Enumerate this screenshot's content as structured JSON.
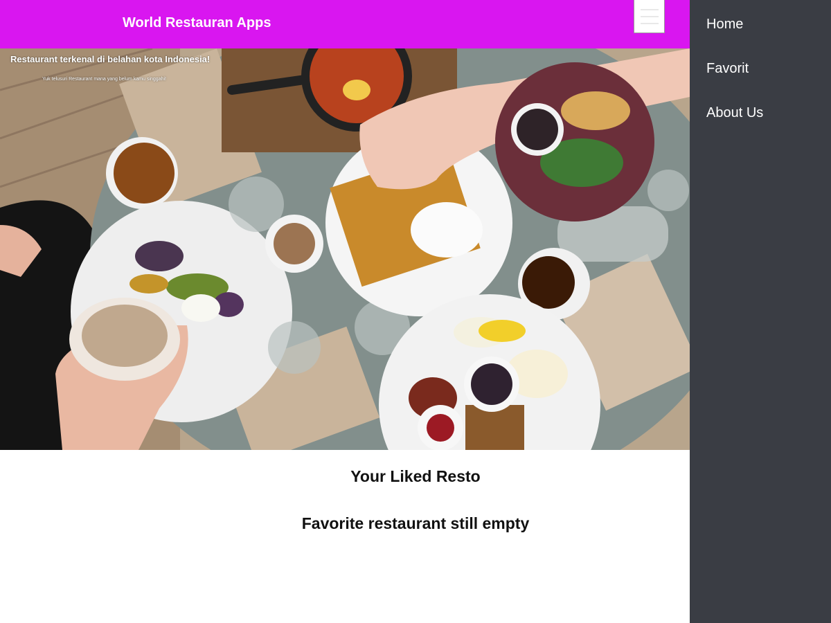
{
  "header": {
    "title": "World Restauran Apps",
    "menu_icon": "hamburger-icon",
    "background": "#d916f0"
  },
  "hero": {
    "tagline": "Restaurant terkenal di belahan kota Indonesia!",
    "subtext": "Yuk telusuri Restaurant mana yang belum kamu singgahi!"
  },
  "content": {
    "section_title": "Your Liked Resto",
    "empty_message": "Favorite restaurant still empty"
  },
  "nav": {
    "background": "#3a3d44",
    "items": [
      {
        "label": "Home"
      },
      {
        "label": "Favorit"
      },
      {
        "label": "About Us"
      }
    ]
  }
}
